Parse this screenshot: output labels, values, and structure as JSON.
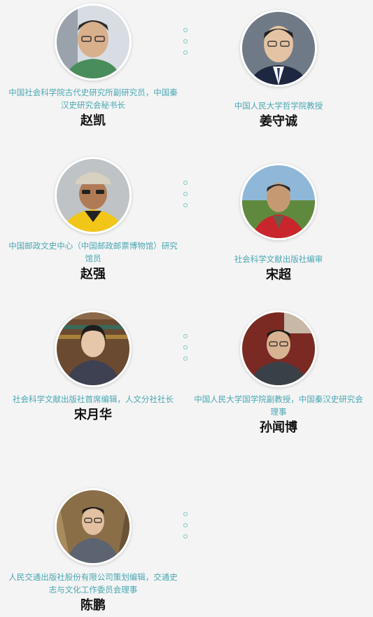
{
  "people": [
    {
      "title": "中国社会科学院古代史研究所副研究员，中国秦汉史研究会秘书长",
      "name": "赵凯"
    },
    {
      "title": "中国人民大学哲学院教授",
      "name": "姜守诚"
    },
    {
      "title": "中国邮政文史中心（中国邮政邮票博物馆）研究馆员",
      "name": "赵强"
    },
    {
      "title": "社会科学文献出版社编审",
      "name": "宋超"
    },
    {
      "title": "社会科学文献出版社首席编辑，人文分社社长",
      "name": "宋月华"
    },
    {
      "title": "中国人民大学国学院副教授，中国秦汉史研究会理事",
      "name": "孙闻博"
    },
    {
      "title": "人民交通出版社股份有限公司策划编辑，交通史志与文化工作委员会理事",
      "name": "陈鹏"
    }
  ],
  "theme": {
    "accent": "#4aa7b3",
    "background": "#f4f4f4"
  }
}
